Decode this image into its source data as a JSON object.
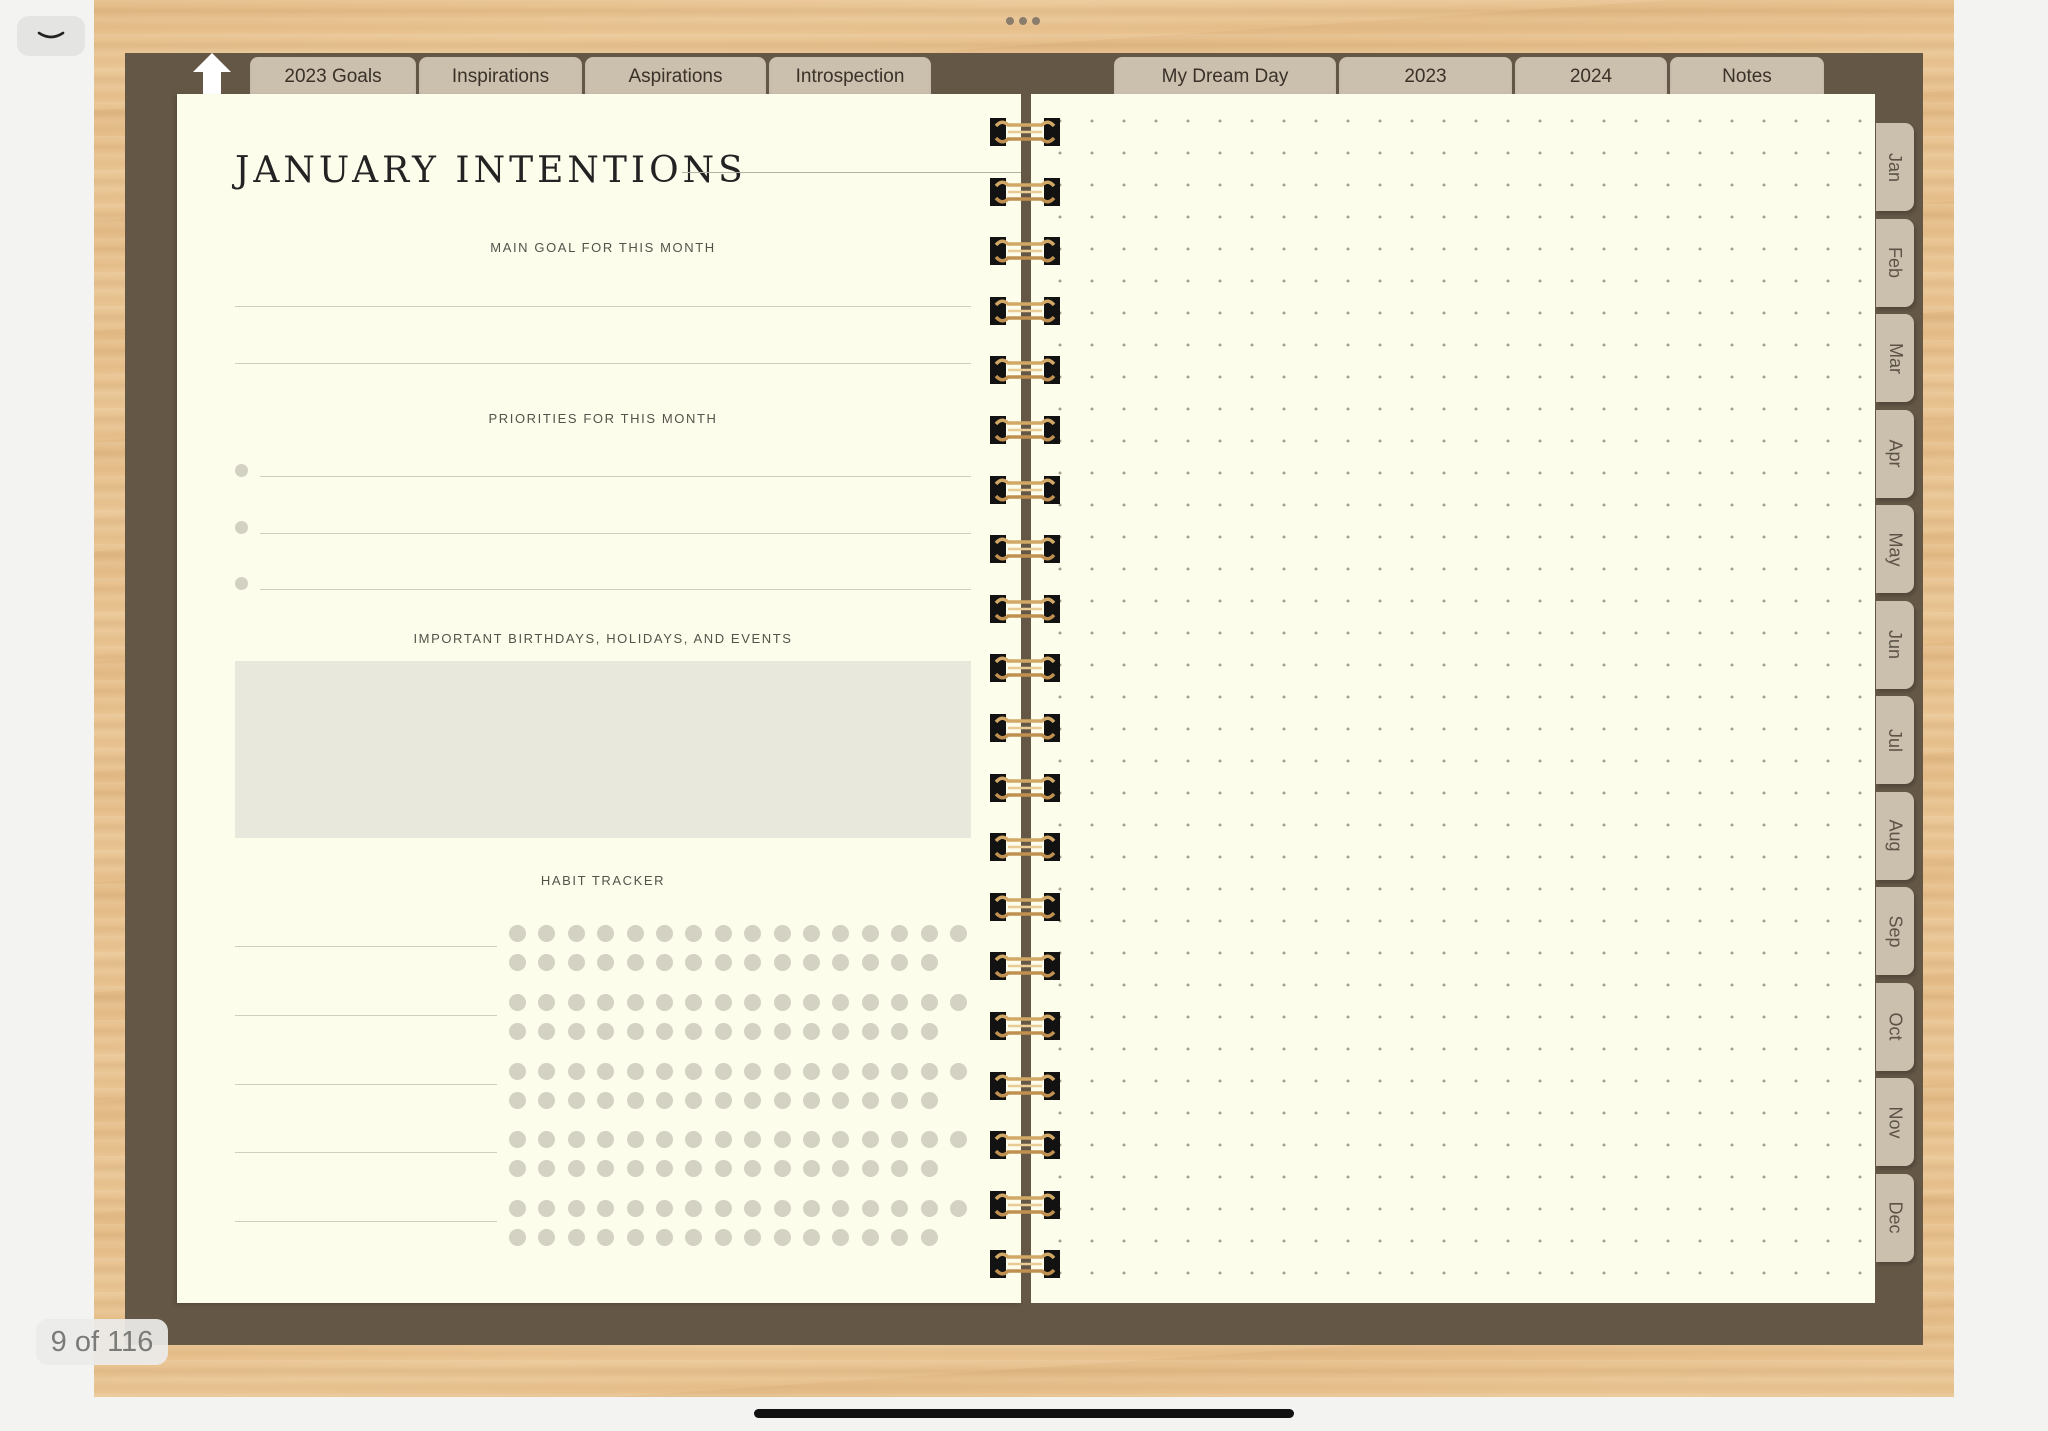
{
  "toolbar": {
    "collapse_icon": "chevron-down-icon",
    "more_icon": "ellipsis-icon"
  },
  "nav": {
    "home_icon": "home-arrow-icon",
    "left_tabs": [
      {
        "label": "2023 Goals"
      },
      {
        "label": "Inspirations"
      },
      {
        "label": "Aspirations"
      },
      {
        "label": "Introspection"
      }
    ],
    "right_tabs": [
      {
        "label": "My Dream Day"
      },
      {
        "label": "2023"
      },
      {
        "label": "2024"
      },
      {
        "label": "Notes"
      }
    ],
    "months": [
      "Jan",
      "Feb",
      "Mar",
      "Apr",
      "May",
      "Jun",
      "Jul",
      "Aug",
      "Sep",
      "Oct",
      "Nov",
      "Dec"
    ]
  },
  "left_page": {
    "title": "JANUARY INTENTIONS",
    "main_goal_label": "MAIN GOAL FOR THIS MONTH",
    "priorities_label": "PRIORITIES FOR THIS MONTH",
    "events_label": "IMPORTANT BIRTHDAYS, HOLIDAYS, AND EVENTS",
    "habit_label": "HABIT TRACKER"
  },
  "right_page": {
    "style": "dot-grid"
  },
  "footer": {
    "page_counter": "9 of 116"
  },
  "colors": {
    "wood": "#e8c28f",
    "cover": "#645746",
    "paper": "#fdfdec",
    "tab": "#cbbfae",
    "dot": "#d3d2c3"
  }
}
